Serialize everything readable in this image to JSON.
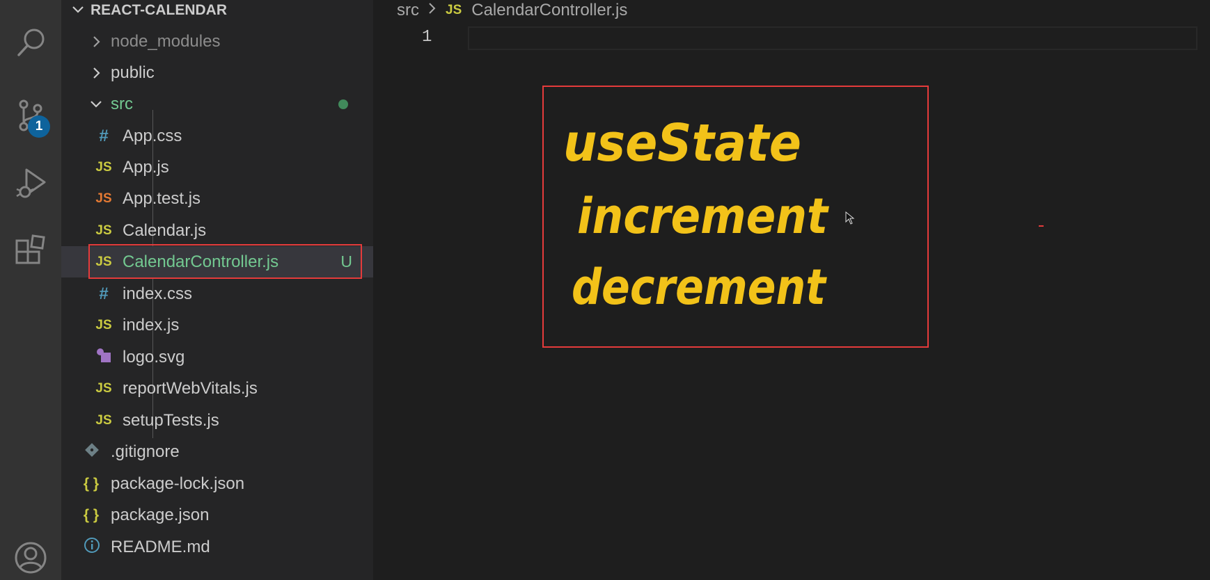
{
  "activity_bar": {
    "icons": [
      "search-icon",
      "source-control-icon",
      "run-debug-icon",
      "extensions-icon",
      "account-icon"
    ],
    "source_control_badge": "1"
  },
  "explorer": {
    "root_label": "REACT-CALENDAR",
    "items": [
      {
        "label": "node_modules",
        "kind": "folder",
        "expanded": false
      },
      {
        "label": "public",
        "kind": "folder",
        "expanded": false
      },
      {
        "label": "src",
        "kind": "folder",
        "expanded": true
      },
      {
        "label": "App.css",
        "icon": "#"
      },
      {
        "label": "App.js",
        "icon": "JS"
      },
      {
        "label": "App.test.js",
        "icon": "JS"
      },
      {
        "label": "Calendar.js",
        "icon": "JS"
      },
      {
        "label": "CalendarController.js",
        "icon": "JS",
        "git_status": "U"
      },
      {
        "label": "index.css",
        "icon": "#"
      },
      {
        "label": "index.js",
        "icon": "JS"
      },
      {
        "label": "logo.svg",
        "icon": "svg"
      },
      {
        "label": "reportWebVitals.js",
        "icon": "JS"
      },
      {
        "label": "setupTests.js",
        "icon": "JS"
      },
      {
        "label": ".gitignore",
        "icon": "git"
      },
      {
        "label": "package-lock.json",
        "icon": "{ }"
      },
      {
        "label": "package.json",
        "icon": "{ }"
      },
      {
        "label": "README.md",
        "icon": "info"
      }
    ]
  },
  "editor": {
    "breadcrumb": {
      "folder": "src",
      "file_icon": "JS",
      "file": "CalendarController.js"
    },
    "line_numbers": [
      "1"
    ]
  },
  "annotation": {
    "lines": [
      "useState",
      "increment",
      "decrement"
    ],
    "ink_color": "#f2c219",
    "box_color": "#e53b3b"
  },
  "colors": {
    "js_icon": "#cbcb41",
    "css_icon": "#519aba",
    "untracked": "#73c991",
    "selection_outline": "#e53b3b"
  }
}
